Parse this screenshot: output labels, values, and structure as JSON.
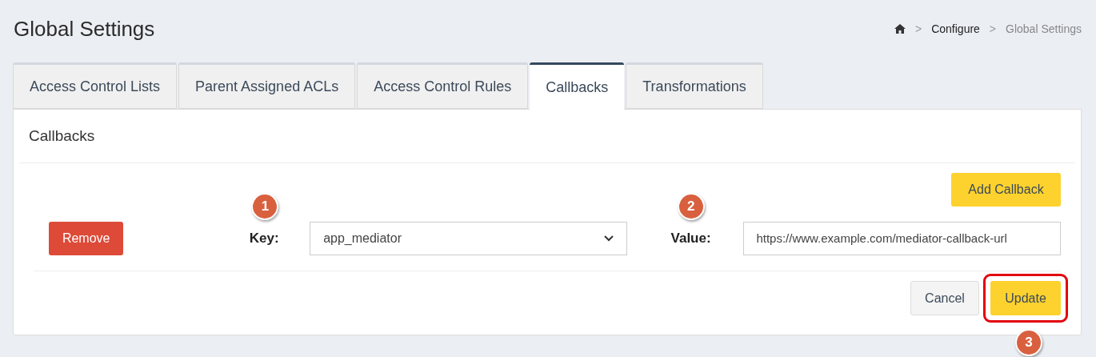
{
  "page_title": "Global Settings",
  "breadcrumb": [
    {
      "label": "Configure",
      "current": false
    },
    {
      "label": "Global Settings",
      "current": true
    }
  ],
  "breadcrumb_separator": ">",
  "tabs": [
    {
      "label": "Access Control Lists",
      "selected": false
    },
    {
      "label": "Parent Assigned ACLs",
      "selected": false
    },
    {
      "label": "Access Control Rules",
      "selected": false
    },
    {
      "label": "Callbacks",
      "selected": true
    },
    {
      "label": "Transformations",
      "selected": false
    }
  ],
  "panel": {
    "title": "Callbacks",
    "add_button": "Add Callback",
    "callback": {
      "remove_button": "Remove",
      "key_label": "Key:",
      "key_value": "app_mediator",
      "value_label": "Value:",
      "value": "https://www.example.com/mediator-callback-url"
    },
    "cancel_button": "Cancel",
    "update_button": "Update"
  },
  "annotations": [
    "1",
    "2",
    "3"
  ]
}
